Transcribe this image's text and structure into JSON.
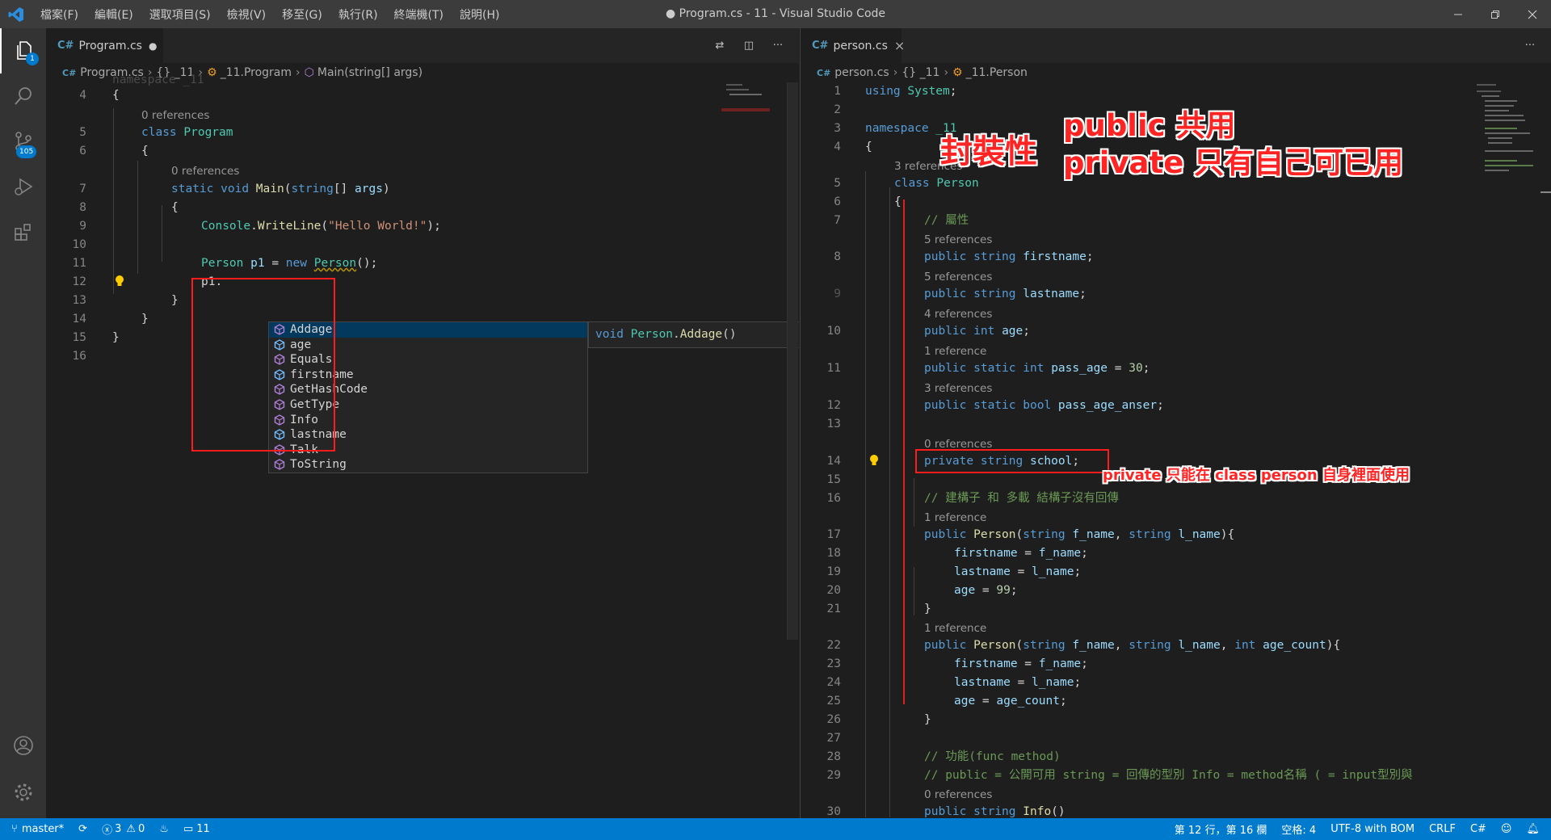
{
  "window": {
    "title": "● Program.cs - 11 - Visual Studio Code",
    "menu": [
      "檔案(F)",
      "編輯(E)",
      "選取項目(S)",
      "檢視(V)",
      "移至(G)",
      "執行(R)",
      "終端機(T)",
      "說明(H)"
    ]
  },
  "activity": {
    "explorer_badge": "1",
    "scm_badge": "105"
  },
  "left_editor": {
    "tab_label": "Program.cs",
    "tab_dirty": "●",
    "breadcrumb": [
      "Program.cs",
      "{} _11",
      "_11.Program",
      "Main(string[] args)"
    ],
    "top_partial": "namespace _11",
    "lines": [
      {
        "n": "4",
        "text": "{"
      },
      {
        "n": "5",
        "lens": "0 references",
        "text": "class Program"
      },
      {
        "n": "6",
        "text": "{"
      },
      {
        "n": "7",
        "lens": "0 references",
        "text": "static void Main(string[] args)"
      },
      {
        "n": "8",
        "text": "{"
      },
      {
        "n": "9",
        "text": "Console.WriteLine(\"Hello World!\");"
      },
      {
        "n": "10",
        "text": ""
      },
      {
        "n": "11",
        "text": "Person p1 = new Person();"
      },
      {
        "n": "12",
        "text": "p1."
      },
      {
        "n": "13",
        "text": "}"
      },
      {
        "n": "14",
        "text": "}"
      },
      {
        "n": "15",
        "text": "}"
      },
      {
        "n": "16",
        "text": ""
      }
    ],
    "suggestions": [
      "Addage",
      "age",
      "Equals",
      "firstname",
      "GetHashCode",
      "GetType",
      "Info",
      "lastname",
      "Talk",
      "ToString"
    ],
    "suggestion_kinds": [
      "method",
      "field",
      "method",
      "field",
      "method",
      "method",
      "method",
      "field",
      "method",
      "method"
    ],
    "selected_suggestion": "Addage",
    "detail": "void Person.Addage()",
    "detail_close": "×"
  },
  "right_editor": {
    "tab_label": "person.cs",
    "tab_close": "×",
    "breadcrumb": [
      "person.cs",
      "{} _11",
      "_11.Person"
    ],
    "lines": [
      {
        "n": "1",
        "text": "using System;"
      },
      {
        "n": "2",
        "text": ""
      },
      {
        "n": "3",
        "text": "namespace _11"
      },
      {
        "n": "4",
        "text": "{"
      },
      {
        "n": "5",
        "lens": "3 references",
        "text": "class Person"
      },
      {
        "n": "6",
        "text": "{"
      },
      {
        "n": "7",
        "text": "// 屬性"
      },
      {
        "n": "8",
        "lens": "5 references",
        "text": "public string firstname;"
      },
      {
        "n": "9",
        "lens": "5 references",
        "text": "public string lastname;"
      },
      {
        "n": "10",
        "lens": "4 references",
        "text": "public int age;"
      },
      {
        "n": "11",
        "lens": "1 reference",
        "text": "public static int pass_age = 30;"
      },
      {
        "n": "12",
        "lens": "3 references",
        "text": "public static bool pass_age_anser;"
      },
      {
        "n": "13",
        "text": ""
      },
      {
        "n": "14",
        "lens": "0 references",
        "text": "private string school;"
      },
      {
        "n": "15",
        "text": ""
      },
      {
        "n": "16",
        "text": "// 建構子 和 多載 結構子沒有回傳"
      },
      {
        "n": "17",
        "lens": "1 reference",
        "text": "public Person(string f_name, string l_name){"
      },
      {
        "n": "18",
        "text": "firstname = f_name;"
      },
      {
        "n": "19",
        "text": "lastname = l_name;"
      },
      {
        "n": "20",
        "text": "age = 99;"
      },
      {
        "n": "21",
        "text": "}"
      },
      {
        "n": "22",
        "lens": "1 reference",
        "text": "public Person(string f_name, string l_name, int age_count){"
      },
      {
        "n": "23",
        "text": "firstname = f_name;"
      },
      {
        "n": "24",
        "text": "lastname = l_name;"
      },
      {
        "n": "25",
        "text": "age = age_count;"
      },
      {
        "n": "26",
        "text": "}"
      },
      {
        "n": "27",
        "text": ""
      },
      {
        "n": "28",
        "text": "// 功能(func method)"
      },
      {
        "n": "29",
        "text": "// public = 公開可用 string = 回傳的型別 Info = method名稱 ( = input型別與"
      },
      {
        "n": "30",
        "lens": "0 references",
        "text": "public string Info()"
      }
    ]
  },
  "annotations": {
    "encapsulation": "封裝性",
    "public_note": "public  共用",
    "private_note": "private 只有自己可已用",
    "private_detail": "private 只能在 class person 自身裡面使用"
  },
  "statusbar": {
    "branch": "master*",
    "errors": "3",
    "warnings": "0",
    "folder_count": "11",
    "position": "第 12 行，第 16 欄",
    "spaces": "空格: 4",
    "encoding": "UTF-8 with BOM",
    "eol": "CRLF",
    "language": "C#"
  },
  "colors": {
    "accent": "#007acc",
    "annotation_red": "#ff2424"
  }
}
